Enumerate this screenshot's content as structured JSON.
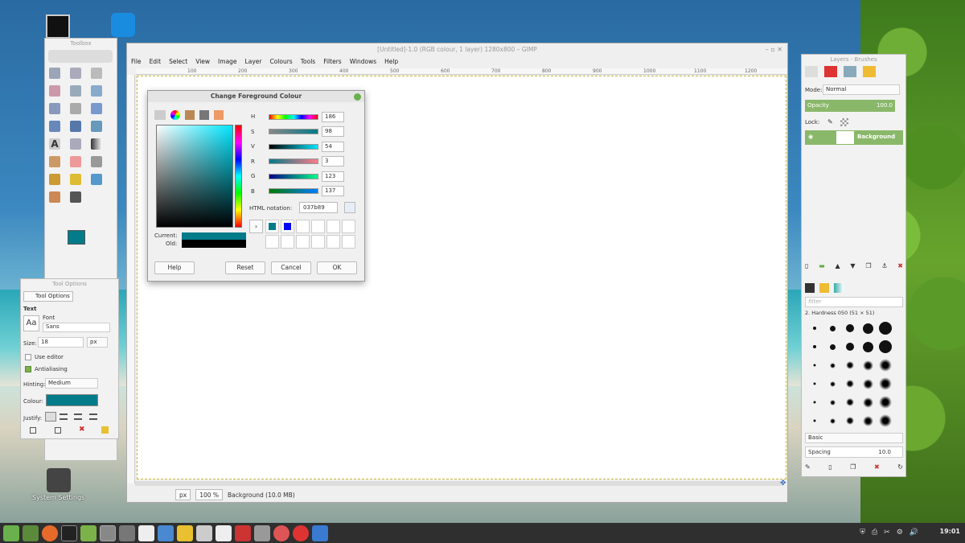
{
  "desktop": {
    "system_settings_label": "System Settings"
  },
  "toolbox": {
    "title": "Toolbox",
    "fg_color": "#037b89",
    "bg_color": "#ffffff"
  },
  "tool_options": {
    "title": "Tool Options",
    "tab_label": "Tool Options",
    "section": "Text",
    "font_label": "Font",
    "font_value": "Sans",
    "size_label": "Size:",
    "size_value": "18",
    "size_unit": "px",
    "use_editor": "Use editor",
    "antialiasing": "Antialiasing",
    "hinting_label": "Hinting:",
    "hinting_value": "Medium",
    "colour_label": "Colour:",
    "justify_label": "Justify:"
  },
  "gimp": {
    "title": "[Untitled]-1.0 (RGB colour, 1 layer) 1280x800 – GIMP",
    "menu": [
      "File",
      "Edit",
      "Select",
      "View",
      "Image",
      "Layer",
      "Colours",
      "Tools",
      "Filters",
      "Windows",
      "Help"
    ],
    "ruler_ticks": [
      "100",
      "200",
      "300",
      "400",
      "500",
      "600",
      "700",
      "800",
      "900",
      "1000",
      "1100",
      "1200"
    ],
    "unit": "px",
    "zoom": "100 %",
    "status": "Background (10.0 MB)"
  },
  "dialog": {
    "title": "Change Foreground Colour",
    "sliders": [
      {
        "label": "H",
        "value": "186",
        "grad": "linear-gradient(90deg,red,yellow,lime,cyan,blue,magenta,red)"
      },
      {
        "label": "S",
        "value": "98",
        "grad": "linear-gradient(90deg,#888,#037b89)"
      },
      {
        "label": "V",
        "value": "54",
        "grad": "linear-gradient(90deg,#000,#00e6ff)"
      },
      {
        "label": "R",
        "value": "3",
        "grad": "linear-gradient(90deg,#007b89,#ff7b89)"
      },
      {
        "label": "G",
        "value": "123",
        "grad": "linear-gradient(90deg,#030089,#03ff89)"
      },
      {
        "label": "B",
        "value": "137",
        "grad": "linear-gradient(90deg,#037b00,#037bff)"
      }
    ],
    "html_label": "HTML notation:",
    "html_value": "037b89",
    "current_label": "Current:",
    "old_label": "Old:",
    "current_color": "#037b89",
    "old_color": "#000000",
    "history": [
      "#037b89",
      "#0000ff"
    ],
    "buttons": {
      "help": "Help",
      "reset": "Reset",
      "cancel": "Cancel",
      "ok": "OK"
    }
  },
  "layers": {
    "title": "Layers - Brushes",
    "mode_label": "Mode:",
    "mode_value": "Normal",
    "opacity_label": "Opacity",
    "opacity_value": "100.0",
    "lock_label": "Lock:",
    "layer_name": "Background",
    "filter_placeholder": "filter",
    "brush_name": "2. Hardness 050 (51 × 51)",
    "brush_set": "Basic",
    "spacing_label": "Spacing",
    "spacing_value": "10.0"
  },
  "taskbar": {
    "clock": "19:01"
  }
}
